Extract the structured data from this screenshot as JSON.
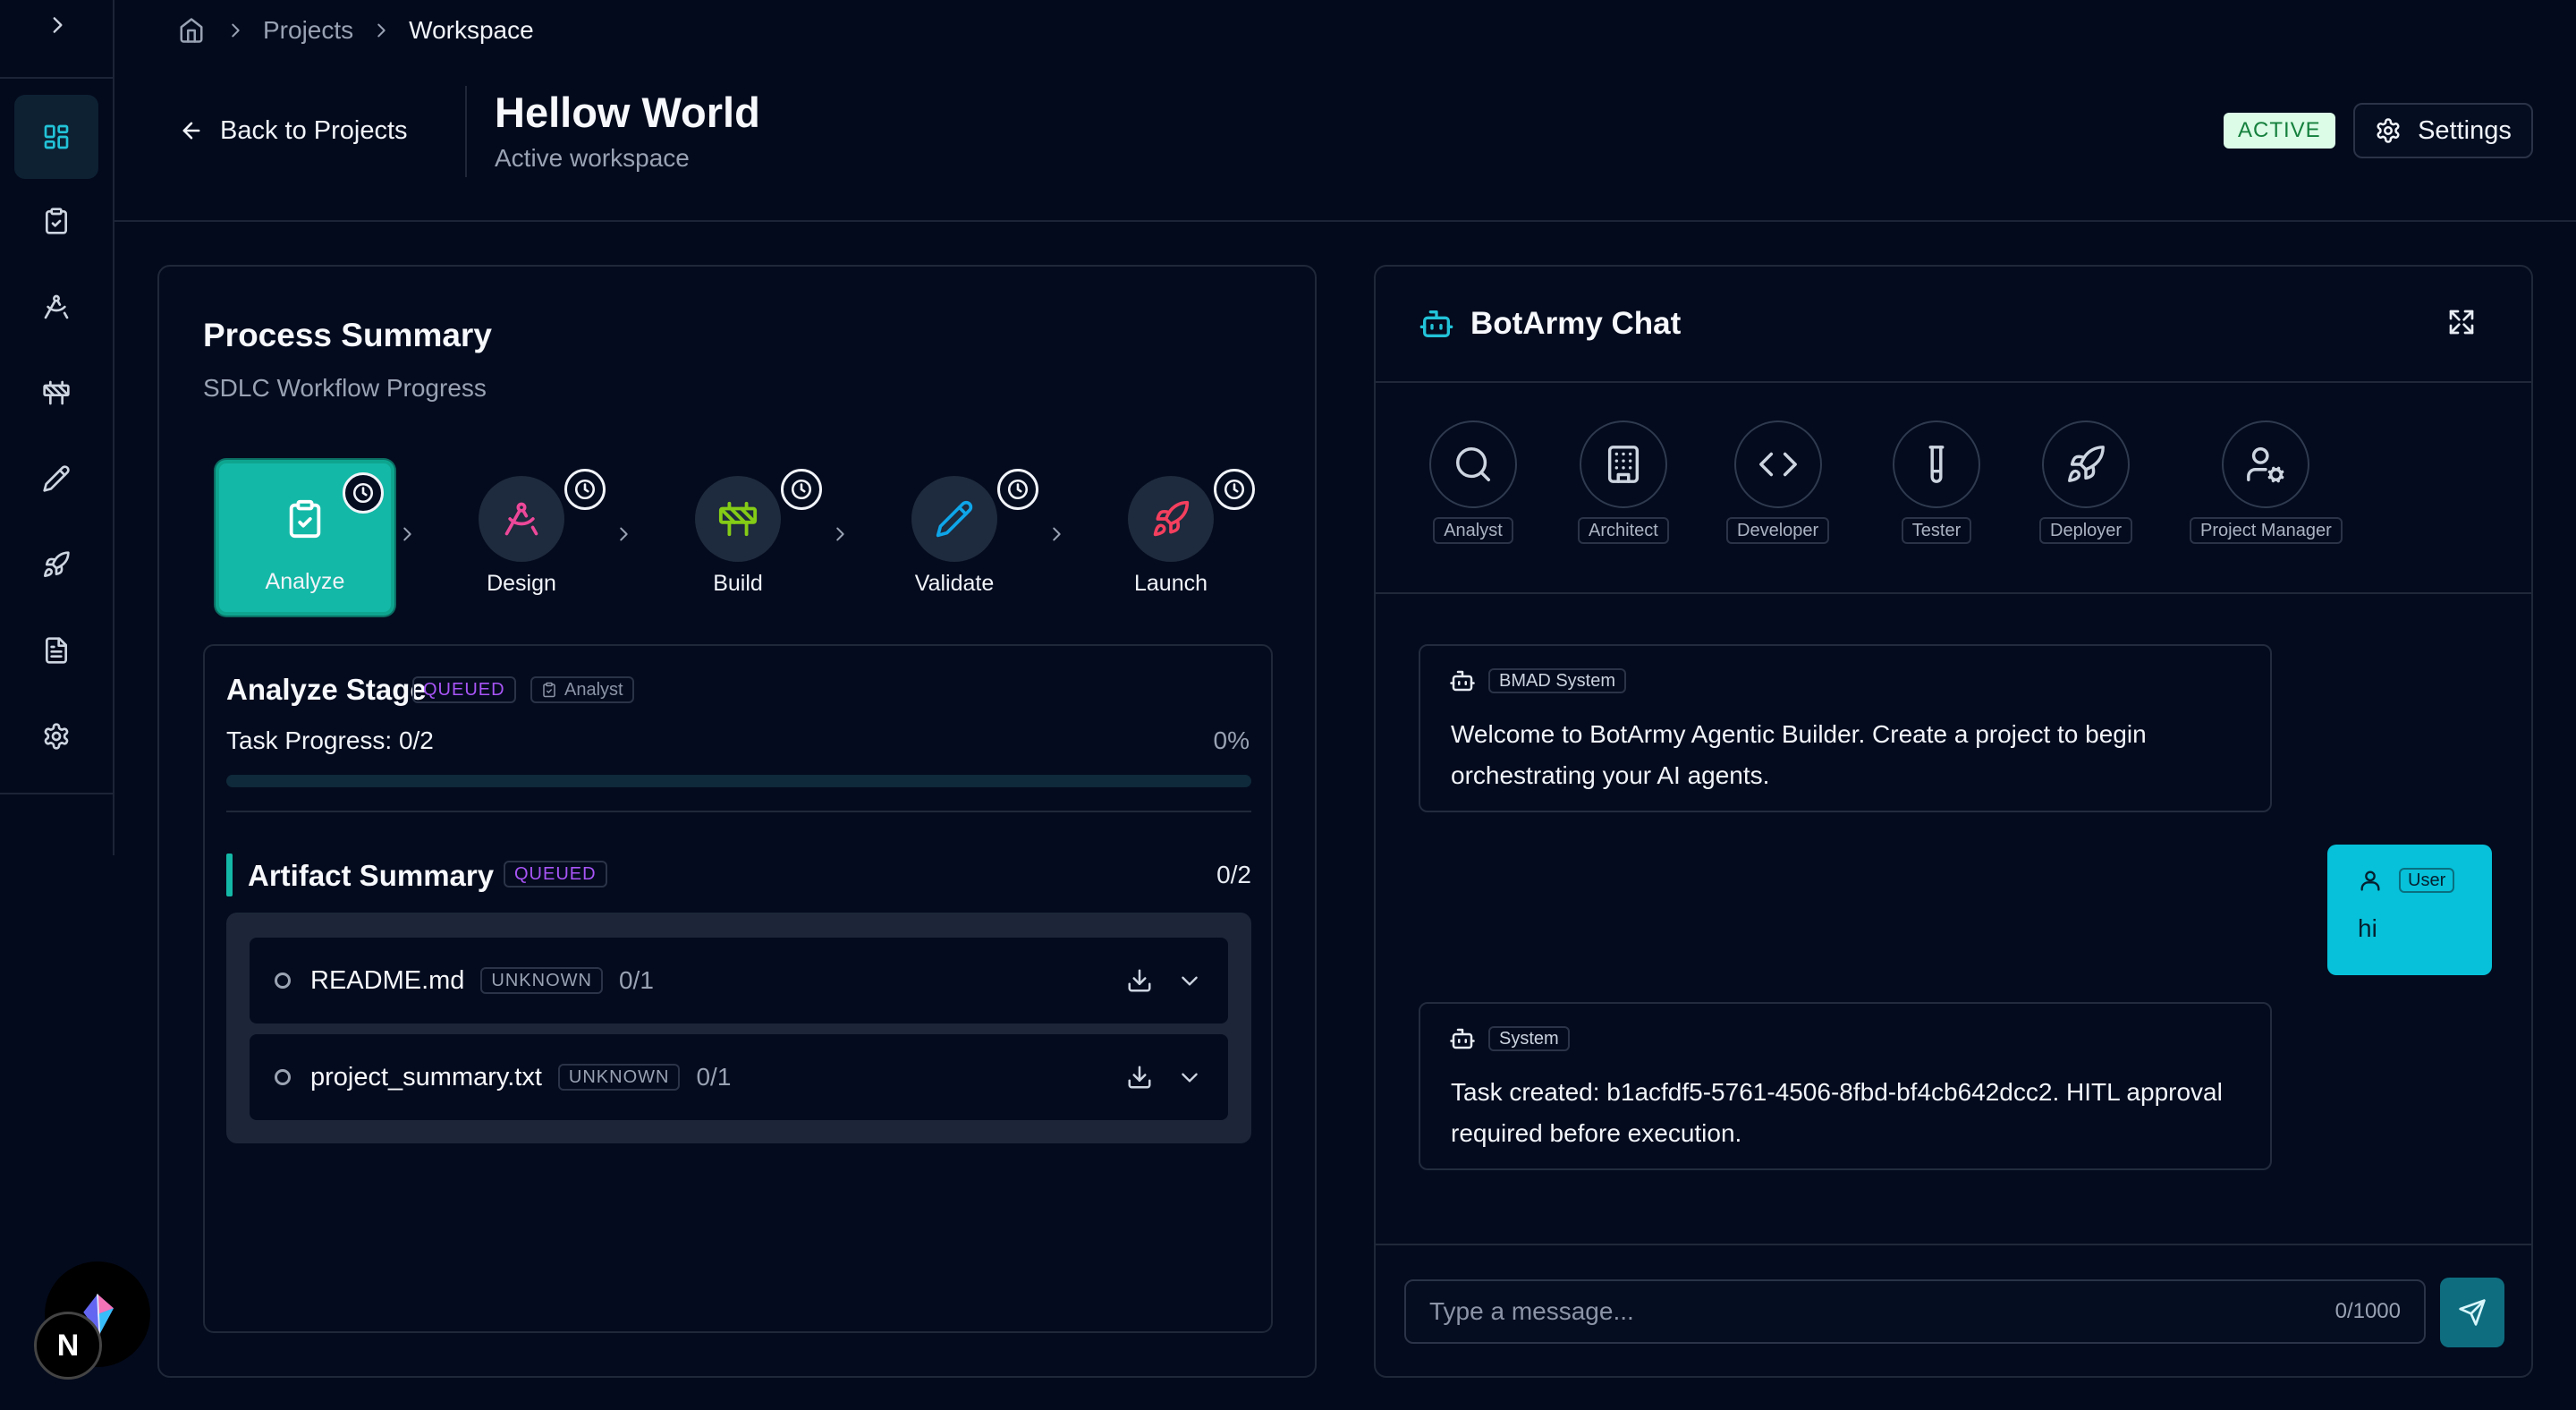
{
  "breadcrumb": {
    "home_icon": "home-icon",
    "items": [
      "Projects",
      "Workspace"
    ]
  },
  "header": {
    "back_label": "Back to Projects",
    "title": "Hellow World",
    "subtitle": "Active workspace",
    "status": "ACTIVE",
    "settings_label": "Settings"
  },
  "sidebar": {
    "items": [
      "dashboard-icon",
      "clipboard-check-icon",
      "compass-icon",
      "barrier-icon",
      "pencil-icon",
      "rocket-icon",
      "file-text-icon",
      "gear-icon"
    ],
    "active_index": 0
  },
  "process": {
    "title": "Process Summary",
    "subtitle": "SDLC Workflow Progress",
    "stages": [
      {
        "label": "Analyze",
        "icon": "clipboard-check-icon",
        "color": "#ffffff",
        "active": true
      },
      {
        "label": "Design",
        "icon": "compass-icon",
        "color": "#ec4899"
      },
      {
        "label": "Build",
        "icon": "barrier-icon",
        "color": "#84cc16"
      },
      {
        "label": "Validate",
        "icon": "pencil-icon",
        "color": "#0ea5e9"
      },
      {
        "label": "Launch",
        "icon": "rocket-icon",
        "color": "#f43f5e"
      }
    ],
    "stage_detail": {
      "title": "Analyze Stage",
      "status": "QUEUED",
      "agent": "Analyst",
      "progress_label": "Task Progress: 0/2",
      "progress_pct": "0%",
      "progress_value": 0
    },
    "artifacts": {
      "title": "Artifact Summary",
      "status": "QUEUED",
      "count": "0/2",
      "items": [
        {
          "name": "README.md",
          "status": "UNKNOWN",
          "count": "0/1"
        },
        {
          "name": "project_summary.txt",
          "status": "UNKNOWN",
          "count": "0/1"
        }
      ]
    }
  },
  "chat": {
    "title": "BotArmy Chat",
    "agents": [
      {
        "label": "Analyst",
        "icon": "search-icon"
      },
      {
        "label": "Architect",
        "icon": "building-icon"
      },
      {
        "label": "Developer",
        "icon": "code-icon"
      },
      {
        "label": "Tester",
        "icon": "test-tube-icon"
      },
      {
        "label": "Deployer",
        "icon": "rocket-icon"
      },
      {
        "label": "Project Manager",
        "icon": "user-cog-icon"
      }
    ],
    "messages": [
      {
        "sender": "BMAD System",
        "text": "Welcome to BotArmy Agentic Builder. Create a project to begin orchestrating your AI agents."
      },
      {
        "sender": "User",
        "text": "hi"
      },
      {
        "sender": "System",
        "text": "Task created: b1acfdf5-5761-4506-8fbd-bf4cb642dcc2. HITL approval required before execution."
      }
    ],
    "input_placeholder": "Type a message...",
    "char_count": "0/1000"
  },
  "dev": {
    "next_badge": "N"
  },
  "colors": {
    "accent": "#14b8a6",
    "chat_accent": "#06c1d9",
    "queued": "#a855f7",
    "active_badge_bg": "#dcfce7",
    "active_badge_text": "#15803d"
  }
}
